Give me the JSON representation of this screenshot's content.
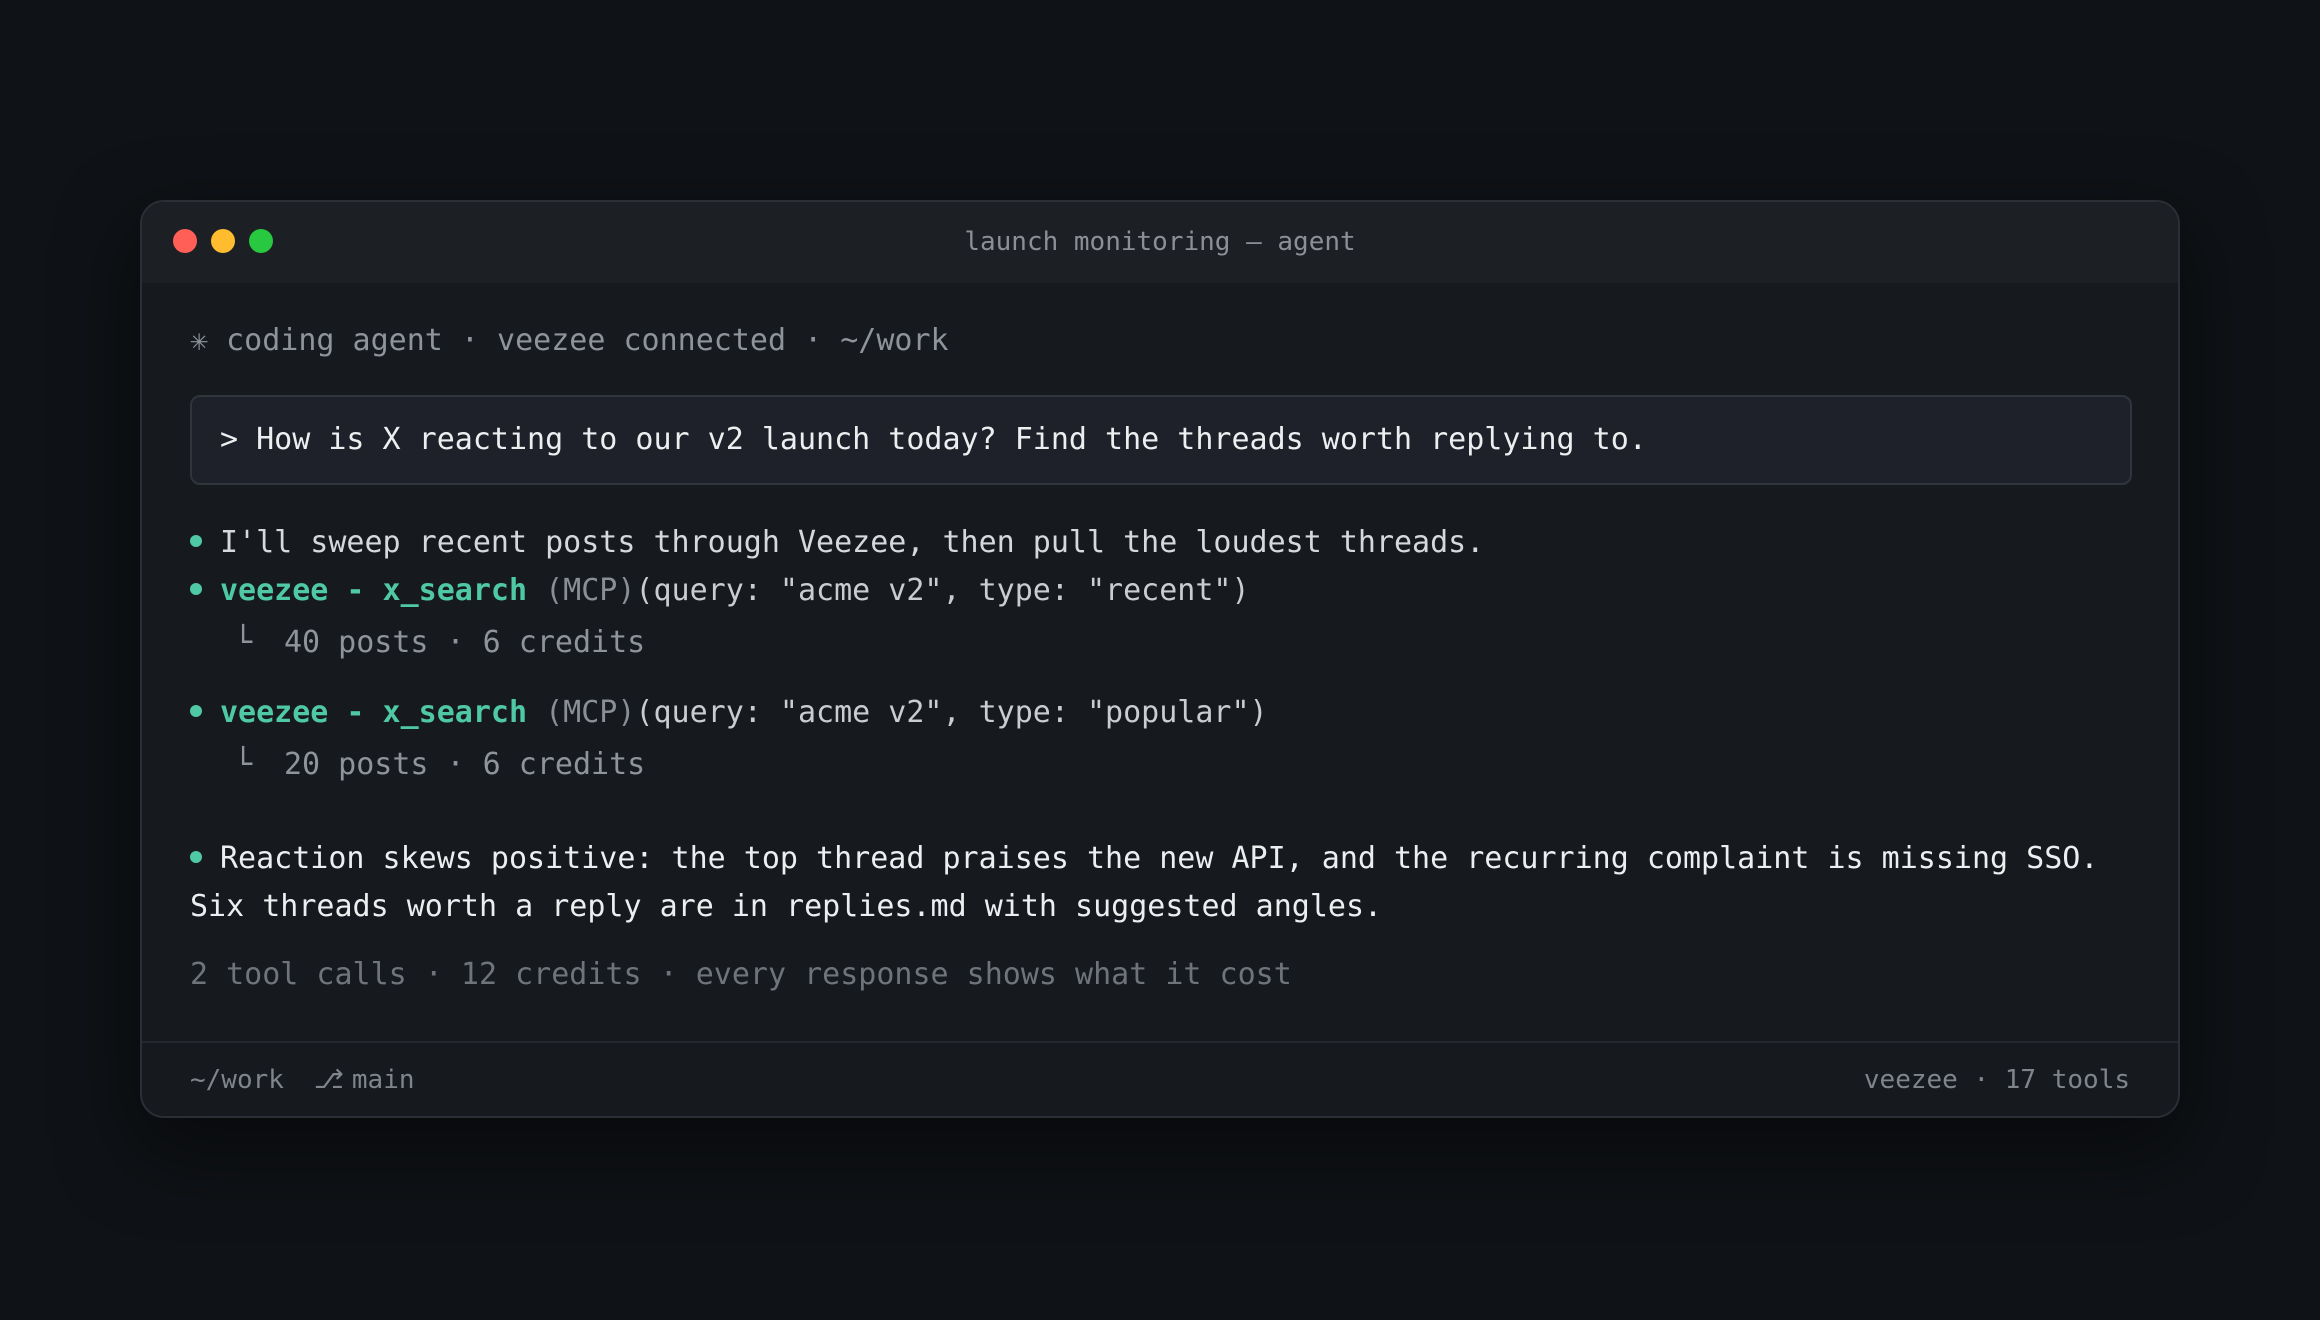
{
  "window": {
    "title": "launch monitoring — agent"
  },
  "session": {
    "icon": "asterisk-icon",
    "icon_glyph": "✳",
    "text": "coding agent · veezee connected · ~/work"
  },
  "prompt": {
    "text": "> How is X reacting to our v2 launch today? Find the threads worth replying to."
  },
  "transcript": {
    "intro": "I'll sweep recent posts through Veezee, then pull the loudest threads.",
    "tool_calls": [
      {
        "name": "veezee - x_search",
        "tag": "(MCP)",
        "args": "(query: \"acme v2\", type: \"recent\")",
        "elbow": "└",
        "result": "40 posts · 6 credits"
      },
      {
        "name": "veezee - x_search",
        "tag": "(MCP)",
        "args": "(query: \"acme v2\", type: \"popular\")",
        "elbow": "└",
        "result": "20 posts · 6 credits"
      }
    ],
    "summary": "Reaction skews positive: the top thread praises the new API, and the recurring complaint is missing SSO. Six threads worth a reply are in replies.md with suggested angles.",
    "stats": "2 tool calls · 12 credits · every response shows what it cost"
  },
  "statusbar": {
    "path": "~/work",
    "branch_icon": "⎇",
    "branch": "main",
    "right": "veezee · 17 tools"
  },
  "colors": {
    "accent": "#4fc9a4",
    "close": "#ff5f57",
    "minimize": "#febc2e",
    "maximize": "#28c840"
  }
}
